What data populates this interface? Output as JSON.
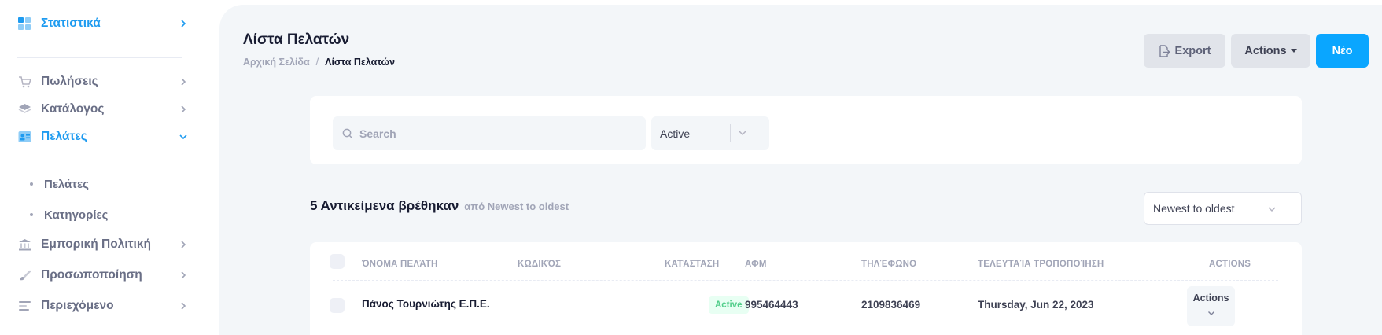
{
  "sidebar": {
    "items": [
      {
        "label": "Στατιστικά",
        "icon": "dashboard-icon",
        "active": true
      },
      {
        "label": "Πωλήσεις",
        "icon": "cart-icon"
      },
      {
        "label": "Κατάλογος",
        "icon": "layers-icon"
      },
      {
        "label": "Πελάτες",
        "icon": "contact-card-icon",
        "active": true,
        "expanded": true
      },
      {
        "label": "Εμπορική Πολιτική",
        "icon": "bank-icon"
      },
      {
        "label": "Προσωποποίηση",
        "icon": "brush-icon"
      },
      {
        "label": "Περιεχόμενο",
        "icon": "text-lines-icon"
      }
    ],
    "subitems": [
      {
        "label": "Πελάτες"
      },
      {
        "label": "Κατηγορίες"
      }
    ]
  },
  "header": {
    "title": "Λίστα Πελατών",
    "breadcrumb": {
      "home": "Αρχική Σελίδα",
      "separator": "/",
      "current": "Λίστα Πελατών"
    },
    "buttons": {
      "export": "Export",
      "actions": "Actions",
      "new": "Νέο"
    }
  },
  "filters": {
    "search_placeholder": "Search",
    "status_value": "Active"
  },
  "results": {
    "count_text": "5 Αντικείμενα βρέθηκαν",
    "sort_note": "από Newest to oldest",
    "sort_value": "Newest to oldest"
  },
  "table": {
    "columns": [
      "ΌΝΟΜΑ ΠΕΛΆΤΗ",
      "ΚΩΔΙΚΌΣ",
      "ΚΑΤΆΣΤΑΣΗ",
      "ΑΦΜ",
      "ΤΗΛΈΦΩΝΟ",
      "ΤΕΛΕΥΤΑΊΑ ΤΡΟΠΟΠΟΊΗΣΗ",
      "ACTIONS"
    ],
    "rows": [
      {
        "name": "Πάνος Τουρνιώτης Ε.Π.Ε.",
        "code": "",
        "status": "Active",
        "afm": "995464443",
        "phone": "2109836469",
        "modified": "Thursday, Jun 22, 2023",
        "actions": "Actions"
      }
    ]
  },
  "colors": {
    "accent": "#0aa6ff",
    "active_nav": "#1e9bf0",
    "success_text": "#50cd89",
    "success_bg": "#e8fff3",
    "page_bg": "#f3f6f9"
  }
}
